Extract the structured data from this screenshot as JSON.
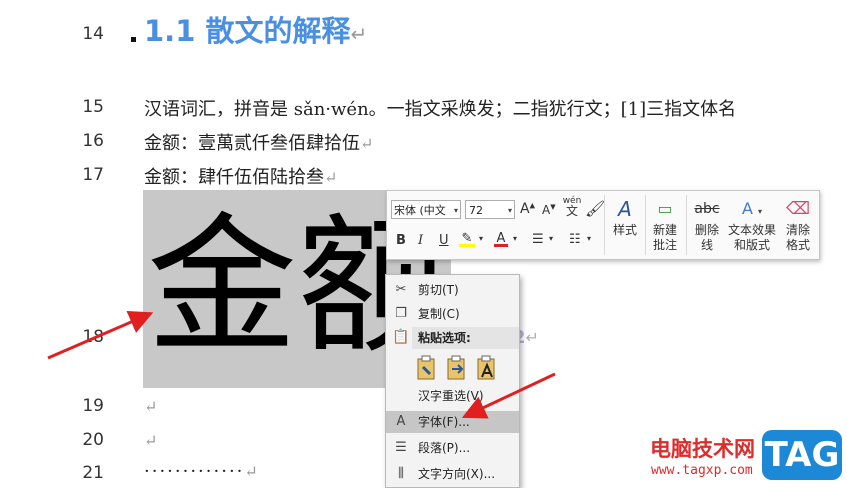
{
  "doc": {
    "lines": [
      {
        "num": "14"
      },
      {
        "num": "15",
        "text": "汉语词汇，拼音是 sǎn·wén。一指文采焕发；二指犹行文；[1]三指文体名"
      },
      {
        "num": "16",
        "text": "金额：壹萬贰仟叁佰肆拾伍"
      },
      {
        "num": "17",
        "text": "金额：肆仟伍佰陆拾叁"
      },
      {
        "num": "18",
        "big_text": "金额：",
        "faint": "2"
      },
      {
        "num": "19"
      },
      {
        "num": "20"
      },
      {
        "num": "21",
        "text": "·············"
      }
    ],
    "heading": "1.1 散文的解释",
    "para_mark": "↵"
  },
  "toolbar": {
    "font_name": "宋体 (中文",
    "font_size": "72",
    "grow_font": "A",
    "shrink_font": "A",
    "phonetic": "wén",
    "phonetic_char": "文",
    "bold": "B",
    "italic": "I",
    "underline": "U",
    "font_color": "A",
    "style_label": "样式",
    "new_comment_l1": "新建",
    "new_comment_l2": "批注",
    "delete_line_l1": "删除",
    "delete_line_l2": "线",
    "strike_icon": "abc",
    "text_effect_l1": "文本效果",
    "text_effect_l2": "和版式",
    "clear_format_l1": "清除",
    "clear_format_l2": "格式"
  },
  "menu": {
    "cut": "剪切(T)",
    "copy": "复制(C)",
    "paste_header": "粘贴选项:",
    "reconvert": "汉字重选(V)",
    "font": "字体(F)...",
    "paragraph": "段落(P)...",
    "text_direction": "文字方向(X)..."
  },
  "watermark": {
    "site_name": "电脑技术网",
    "url": "www.tagxp.com",
    "tag": "TAG"
  },
  "colors": {
    "heading": "#4a90e2",
    "selection": "#c8c8c8",
    "arrow": "#e02020",
    "menu_highlight": "#c6c6c6",
    "watermark_red": "#e02b2b",
    "watermark_blue": "#1d88d6"
  }
}
